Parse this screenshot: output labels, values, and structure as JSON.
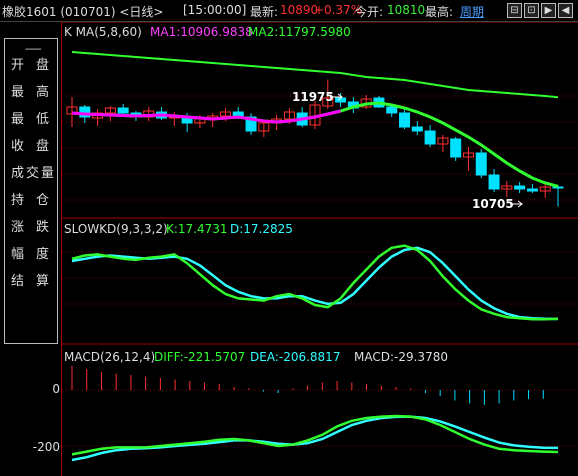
{
  "header": {
    "title": "橡胶1601 (010701) <日线>",
    "time": "[15:00:00]",
    "latest_label": "最新:",
    "latest_value": "10890",
    "change": "+0.37%",
    "open_label": "今开:",
    "open_value": "10810",
    "high_label": "最高:",
    "period_link": "周期"
  },
  "window_buttons": [
    "⊟",
    "⊡",
    "▶",
    "◀"
  ],
  "sidebar": {
    "dashes": "------",
    "items": [
      "开盘",
      "最高",
      "最低",
      "收盘",
      "成交量",
      "持仓",
      "涨跌",
      "幅度",
      "结算"
    ]
  },
  "panels": {
    "price": {
      "legend_prefix": "K  MA(5,8,60)",
      "ma1": "MA1:10906.9838",
      "ma2": "MA2:11797.5980",
      "high_note": "11975",
      "low_note": "10705"
    },
    "kd": {
      "legend_prefix": "SLOWKD(9,3,3,2)",
      "k": "K:17.4731",
      "d": "D:17.2825"
    },
    "macd": {
      "legend_prefix": "MACD(26,12,4)",
      "diff": "DIFF:-221.5707",
      "dea": "DEA:-206.8817",
      "macd": "MACD:-29.3780",
      "yticks": [
        "0",
        "-200"
      ]
    }
  },
  "colors": {
    "up": "#ff3030",
    "down": "#00e0ff",
    "ma_short": "#ff00ff",
    "ma_long": "#30ff30",
    "grid": "#8b0000",
    "text": "#dddddd"
  },
  "chart_data": [
    {
      "type": "candlestick",
      "title": "K MA(5,8,60)",
      "candles": [
        {
          "o": 11630,
          "h": 11800,
          "l": 11500,
          "c": 11700
        },
        {
          "o": 11700,
          "h": 11720,
          "l": 11540,
          "c": 11600
        },
        {
          "o": 11590,
          "h": 11680,
          "l": 11510,
          "c": 11640
        },
        {
          "o": 11640,
          "h": 11710,
          "l": 11560,
          "c": 11690
        },
        {
          "o": 11690,
          "h": 11730,
          "l": 11600,
          "c": 11640
        },
        {
          "o": 11640,
          "h": 11660,
          "l": 11560,
          "c": 11600
        },
        {
          "o": 11600,
          "h": 11700,
          "l": 11560,
          "c": 11660
        },
        {
          "o": 11650,
          "h": 11700,
          "l": 11570,
          "c": 11590
        },
        {
          "o": 11590,
          "h": 11650,
          "l": 11510,
          "c": 11600
        },
        {
          "o": 11590,
          "h": 11640,
          "l": 11450,
          "c": 11540
        },
        {
          "o": 11540,
          "h": 11620,
          "l": 11490,
          "c": 11590
        },
        {
          "o": 11580,
          "h": 11640,
          "l": 11500,
          "c": 11610
        },
        {
          "o": 11610,
          "h": 11690,
          "l": 11560,
          "c": 11650
        },
        {
          "o": 11650,
          "h": 11700,
          "l": 11580,
          "c": 11600
        },
        {
          "o": 11600,
          "h": 11640,
          "l": 11420,
          "c": 11460
        },
        {
          "o": 11460,
          "h": 11560,
          "l": 11400,
          "c": 11540
        },
        {
          "o": 11540,
          "h": 11620,
          "l": 11470,
          "c": 11580
        },
        {
          "o": 11580,
          "h": 11690,
          "l": 11530,
          "c": 11650
        },
        {
          "o": 11640,
          "h": 11700,
          "l": 11500,
          "c": 11520
        },
        {
          "o": 11520,
          "h": 11760,
          "l": 11480,
          "c": 11720
        },
        {
          "o": 11710,
          "h": 11975,
          "l": 11680,
          "c": 11790
        },
        {
          "o": 11790,
          "h": 11840,
          "l": 11700,
          "c": 11750
        },
        {
          "o": 11750,
          "h": 11800,
          "l": 11640,
          "c": 11690
        },
        {
          "o": 11700,
          "h": 11820,
          "l": 11680,
          "c": 11780
        },
        {
          "o": 11790,
          "h": 11810,
          "l": 11690,
          "c": 11700
        },
        {
          "o": 11700,
          "h": 11730,
          "l": 11600,
          "c": 11640
        },
        {
          "o": 11640,
          "h": 11680,
          "l": 11480,
          "c": 11500
        },
        {
          "o": 11500,
          "h": 11560,
          "l": 11420,
          "c": 11460
        },
        {
          "o": 11460,
          "h": 11520,
          "l": 11300,
          "c": 11330
        },
        {
          "o": 11330,
          "h": 11420,
          "l": 11250,
          "c": 11390
        },
        {
          "o": 11380,
          "h": 11400,
          "l": 11160,
          "c": 11200
        },
        {
          "o": 11200,
          "h": 11300,
          "l": 11060,
          "c": 11240
        },
        {
          "o": 11240,
          "h": 11280,
          "l": 10990,
          "c": 11020
        },
        {
          "o": 11020,
          "h": 11080,
          "l": 10850,
          "c": 10880
        },
        {
          "o": 10880,
          "h": 10960,
          "l": 10800,
          "c": 10910
        },
        {
          "o": 10910,
          "h": 10950,
          "l": 10840,
          "c": 10880
        },
        {
          "o": 10880,
          "h": 10930,
          "l": 10840,
          "c": 10860
        },
        {
          "o": 10860,
          "h": 10940,
          "l": 10790,
          "c": 10900
        },
        {
          "o": 10900,
          "h": 10920,
          "l": 10705,
          "c": 10890
        }
      ],
      "ma1": [
        11640,
        11630,
        11625,
        11620,
        11615,
        11610,
        11615,
        11620,
        11610,
        11600,
        11590,
        11580,
        11590,
        11600,
        11580,
        11560,
        11550,
        11560,
        11580,
        11600,
        11630,
        11660,
        11700,
        11730,
        11740,
        11720,
        11690,
        11650,
        11600,
        11540,
        11470,
        11400,
        11320,
        11230,
        11140,
        11060,
        10990,
        10940,
        10907
      ],
      "ma2": [
        12250,
        12240,
        12230,
        12220,
        12210,
        12200,
        12190,
        12180,
        12170,
        12160,
        12150,
        12140,
        12130,
        12120,
        12110,
        12100,
        12090,
        12080,
        12070,
        12060,
        12050,
        12040,
        12020,
        12000,
        11990,
        11980,
        11970,
        11950,
        11930,
        11910,
        11890,
        11870,
        11860,
        11850,
        11840,
        11830,
        11820,
        11810,
        11797
      ],
      "annotations": [
        "11975",
        "10705"
      ]
    },
    {
      "type": "line",
      "title": "SLOWKD(9,3,3,2)",
      "series": [
        {
          "name": "K",
          "values": [
            72,
            75,
            76,
            74,
            72,
            71,
            73,
            74,
            76,
            68,
            58,
            48,
            40,
            36,
            35,
            34,
            38,
            40,
            36,
            30,
            28,
            36,
            50,
            62,
            74,
            82,
            84,
            80,
            70,
            56,
            44,
            34,
            26,
            22,
            19,
            18,
            17,
            17,
            17.4731
          ]
        },
        {
          "name": "D",
          "values": [
            70,
            72,
            74,
            75,
            74,
            73,
            72,
            73,
            74,
            72,
            66,
            57,
            48,
            42,
            38,
            36,
            36,
            38,
            38,
            34,
            31,
            32,
            40,
            52,
            64,
            74,
            80,
            82,
            78,
            68,
            56,
            44,
            34,
            27,
            22,
            19,
            18,
            17.5,
            17.2825
          ]
        }
      ],
      "ylim": [
        0,
        100
      ]
    },
    {
      "type": "line",
      "title": "MACD(26,12,4)",
      "series": [
        {
          "name": "DIFF",
          "values": [
            -230,
            -220,
            -210,
            -205,
            -205,
            -205,
            -200,
            -195,
            -190,
            -185,
            -178,
            -175,
            -180,
            -190,
            -200,
            -195,
            -180,
            -160,
            -130,
            -110,
            -100,
            -95,
            -93,
            -95,
            -105,
            -125,
            -150,
            -175,
            -195,
            -210,
            -215,
            -218,
            -220,
            -221.5707
          ]
        },
        {
          "name": "DEA",
          "values": [
            -250,
            -240,
            -225,
            -215,
            -210,
            -208,
            -205,
            -200,
            -196,
            -192,
            -186,
            -180,
            -180,
            -185,
            -192,
            -195,
            -190,
            -175,
            -150,
            -125,
            -110,
            -100,
            -96,
            -95,
            -100,
            -112,
            -130,
            -150,
            -170,
            -188,
            -198,
            -203,
            -206,
            -206.8817
          ]
        },
        {
          "name": "MACD",
          "values": [
            80,
            70,
            60,
            55,
            50,
            45,
            40,
            35,
            30,
            25,
            20,
            10,
            5,
            -5,
            -10,
            5,
            15,
            25,
            30,
            25,
            20,
            15,
            10,
            5,
            -10,
            -20,
            -35,
            -45,
            -50,
            -45,
            -35,
            -30,
            -29.378
          ]
        }
      ]
    }
  ]
}
